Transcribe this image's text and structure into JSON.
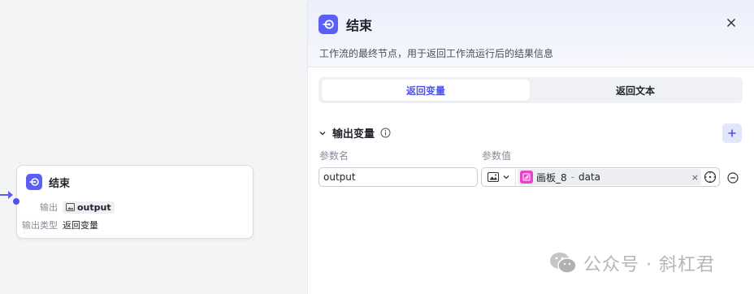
{
  "node": {
    "title": "结束",
    "output_label": "输出",
    "output_value": "output",
    "type_label": "输出类型",
    "type_value": "返回变量"
  },
  "panel": {
    "title": "结束",
    "description": "工作流的最终节点，用于返回工作流运行后的结果信息",
    "tabs": [
      {
        "label": "返回变量",
        "active": true
      },
      {
        "label": "返回文本",
        "active": false
      }
    ],
    "section_title": "输出变量",
    "param_name_label": "参数名",
    "param_value_label": "参数值",
    "row": {
      "name": "output",
      "ref_node": "画板_8",
      "ref_sep": "-",
      "ref_field": "data",
      "clear": "×"
    }
  },
  "watermark": {
    "text": "公众号 · 斜杠君"
  },
  "colors": {
    "accent": "#4d53e8",
    "node_icon": "#5b5ff6",
    "ref_icon": "#e545c6"
  },
  "icons": [
    "end-icon",
    "close-icon",
    "info-icon",
    "plus-icon",
    "image-icon",
    "chevron-down-icon",
    "variable-picker-icon",
    "minus-circle-icon",
    "wechat-icon"
  ]
}
